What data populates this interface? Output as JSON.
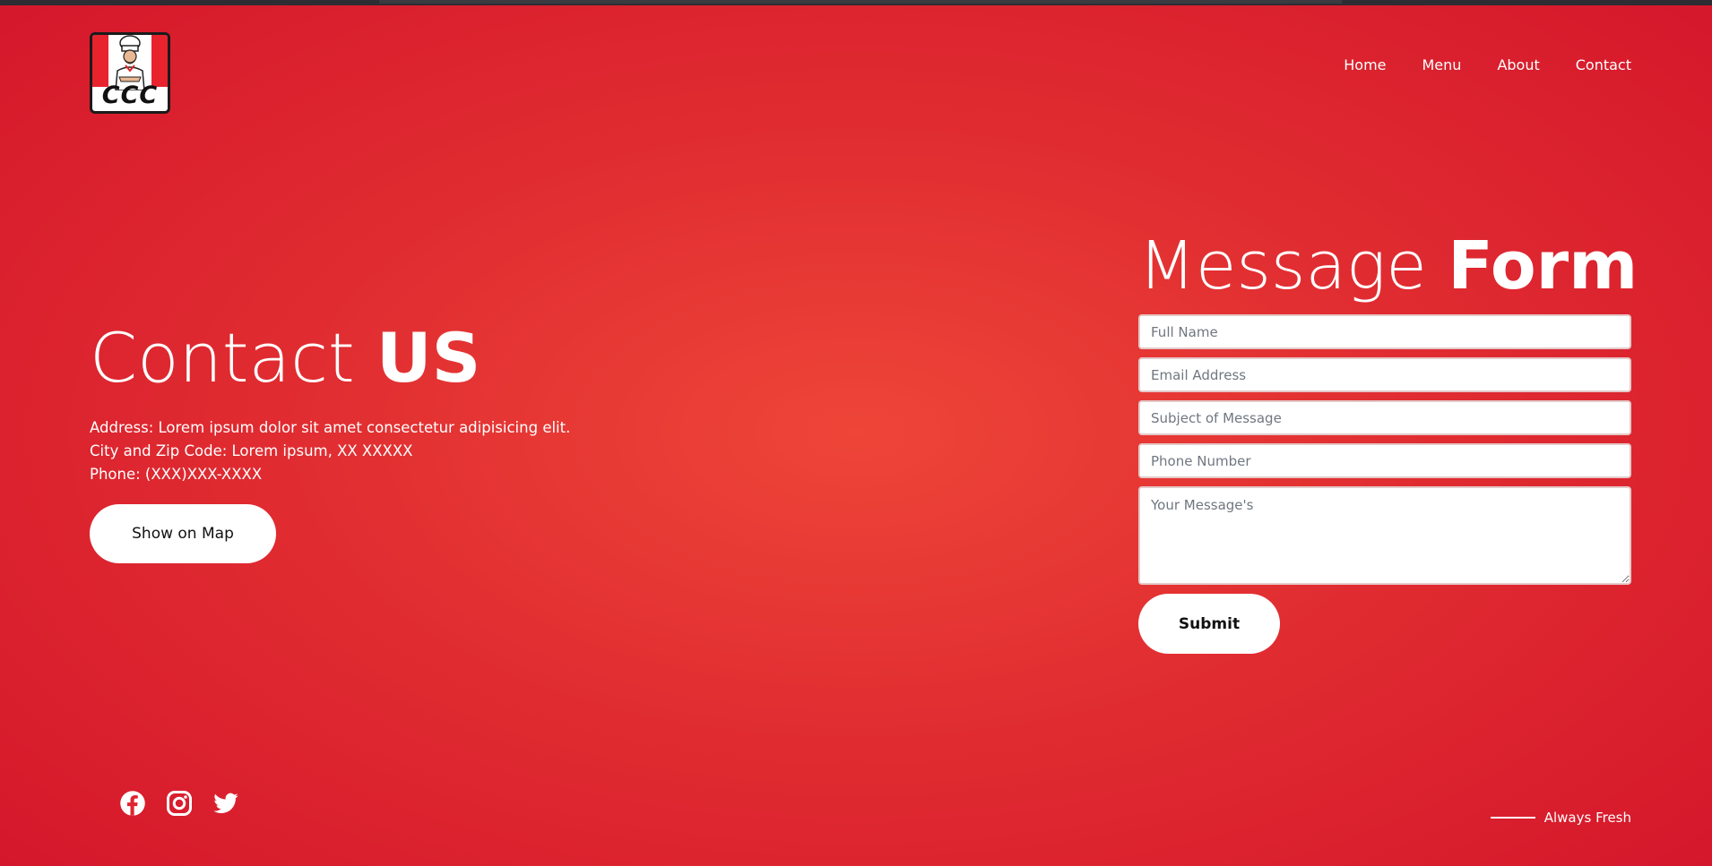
{
  "brand": {
    "logo_text": "CCC"
  },
  "nav": {
    "items": [
      "Home",
      "Menu",
      "About",
      "Contact"
    ]
  },
  "contact": {
    "title_light": "Contact",
    "title_bold": "US",
    "address": "Address: Lorem ipsum dolor sit amet consectetur adipisicing elit.",
    "city": "City and Zip Code: Lorem ipsum, XX XXXXX",
    "phone": "Phone: (XXX)XXX-XXXX",
    "map_button": "Show on Map"
  },
  "form": {
    "title_light": "Message",
    "title_bold": "Form",
    "full_name_placeholder": "Full Name",
    "email_placeholder": "Email Address",
    "subject_placeholder": "Subject of Message",
    "phone_placeholder": "Phone Number",
    "message_placeholder": "Your Message's",
    "submit_label": "Submit"
  },
  "socials": [
    "facebook-icon",
    "instagram-icon",
    "twitter-icon"
  ],
  "footer": {
    "tagline": "Always Fresh"
  },
  "colors": {
    "accent": "#e0242f",
    "background_center": "#ee4538",
    "background_edge": "#d3132a"
  }
}
